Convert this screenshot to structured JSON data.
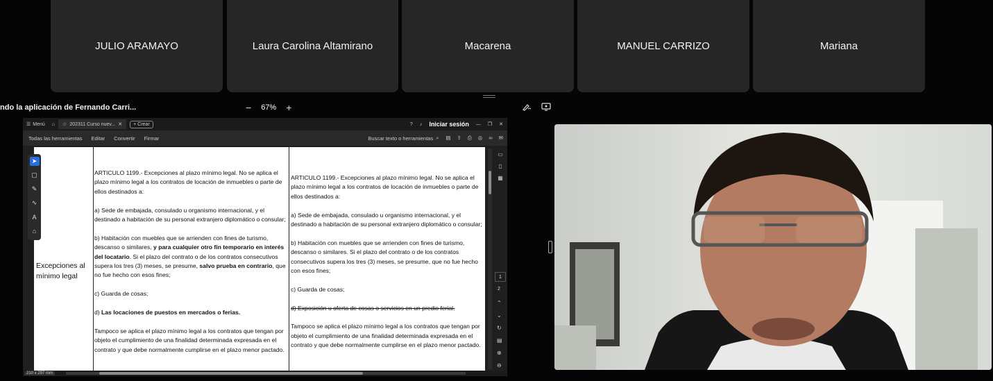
{
  "participants": [
    {
      "name": "JULIO ARAMAYO"
    },
    {
      "name": "Laura Carolina Altamirano"
    },
    {
      "name": "Macarena"
    },
    {
      "name": "MANUEL CARRIZO"
    },
    {
      "name": "Mariana"
    }
  ],
  "share": {
    "title": "ndo la aplicación de Fernando Carri...",
    "zoom_minus": "−",
    "zoom_level": "67%",
    "zoom_plus": "+"
  },
  "app": {
    "menu_label": "Menú",
    "tab_label": "202311 Curso nuev...",
    "create_label": "Crear",
    "signin_label": "Iniciar sesión",
    "toolbar_items": [
      "Todas las herramientas",
      "Editar",
      "Convertir",
      "Firmar"
    ],
    "search_placeholder": "Buscar texto o herramientas",
    "page_current": "1",
    "page_next": "2",
    "page_size": "210 x 297 mm"
  },
  "document": {
    "row_label_1": "Excepciones al",
    "row_label_2": "mínimo legal",
    "left": {
      "p1": "ARTICULO 1199.- Excepciones al plazo mínimo legal. No se aplica el plazo mínimo legal a los contratos de locación de inmuebles o parte de ellos destinados a:",
      "p2": "a) Sede de embajada, consulado u organismo internacional, y el destinado a habitación de su personal extranjero diplomático o consular;",
      "p3_a": "b) Habitación con muebles que se arrienden con fines de turismo, descanso o similares, ",
      "p3_b": "y para cualquier otro fin temporario en interés del locatario",
      "p3_c": ". Si el plazo del contrato o de los contratos consecutivos supera los tres (3) meses, se presume, ",
      "p3_d": "salvo prueba en contrario",
      "p3_e": ", que no fue hecho con esos fines;",
      "p4": "c) Guarda de cosas;",
      "p5_a": "d) ",
      "p5_b": "Las locaciones de puestos en mercados o ferias.",
      "p6": "Tampoco se aplica el plazo mínimo legal a los contratos que tengan por objeto el cumplimiento de una finalidad determinada expresada en el contrato y que debe normalmente cumplirse en el plazo menor pactado."
    },
    "right": {
      "p1": "ARTICULO 1199.- Excepciones al plazo mínimo legal. No se aplica el plazo mínimo legal a los contratos de locación de inmuebles o parte de ellos destinados a:",
      "p2": "a) Sede de embajada, consulado u organismo internacional, y el destinado a habitación de su personal extranjero diplomático o consular;",
      "p3": "b) Habitación con muebles que se arrienden con fines de turismo, descanso o similares. Si el plazo del contrato o de los contratos consecutivos supera los tres (3) meses, se presume, que no fue hecho con esos fines;",
      "p4": "c) Guarda de cosas;",
      "p5": "d) Exposición u oferta de cosas o servicios en un predio ferial.",
      "p6": "Tampoco se aplica el plazo mínimo legal a los contratos que tengan por objeto el cumplimiento de una finalidad determinada expresada en el contrato y que debe normalmente cumplirse en el plazo menor pactado."
    }
  },
  "colors": {
    "tile_bg": "#262626",
    "accent_blue": "#2a6ede"
  }
}
